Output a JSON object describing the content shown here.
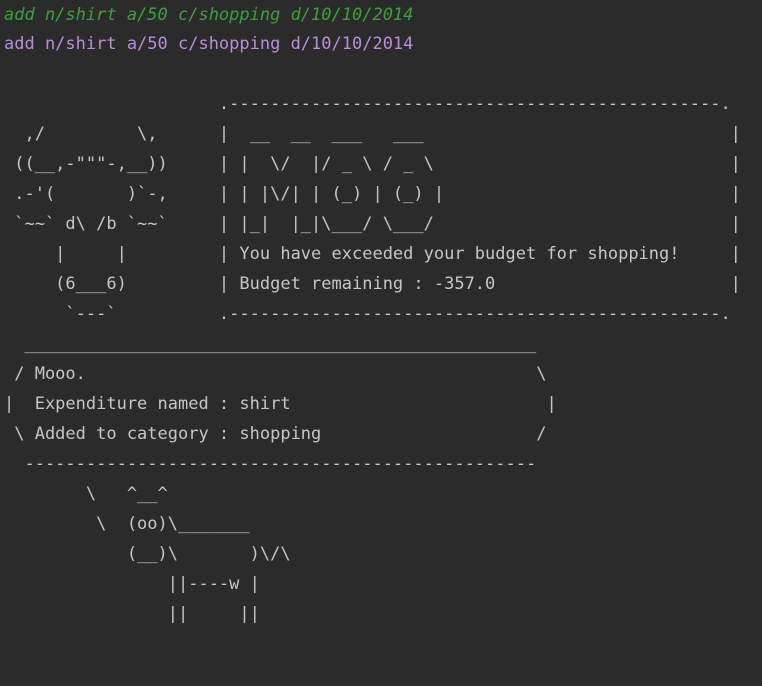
{
  "colors": {
    "background": "#2b2b2b",
    "echo_text": "#3f9f3f",
    "command_text": "#b98edb",
    "output_text": "#c6c6c6"
  },
  "console": {
    "echo_line": "add n/shirt a/50 c/shopping d/10/10/2014",
    "command_line": "add n/shirt a/50 c/shopping d/10/10/2014",
    "output_lines": [
      "",
      "                     .------------------------------------------------.",
      "  ,/         \\,      |  __  __  ___   ___                              |",
      " ((__,-\"\"\"-,__))     | |  \\/  |/ _ \\ / _ \\                             |",
      " .-'(       )`-,     | | |\\/| | (_) | (_) |                            |",
      " `~~` d\\ /b `~~`     | |_|  |_|\\___/ \\___/                             |",
      "     |     |         | You have exceeded your budget for shopping!     |",
      "     (6___6)         | Budget remaining : -357.0                       |",
      "      `---`          .------------------------------------------------.",
      "  __________________________________________________",
      " / Mooo.                                            \\",
      "|  Expenditure named : shirt                         |",
      " \\ Added to category : shopping                     /",
      "  --------------------------------------------------",
      "        \\   ^__^",
      "         \\  (oo)\\_______",
      "            (__)\\       )\\/\\",
      "                ||----w |",
      "                ||     ||"
    ]
  }
}
